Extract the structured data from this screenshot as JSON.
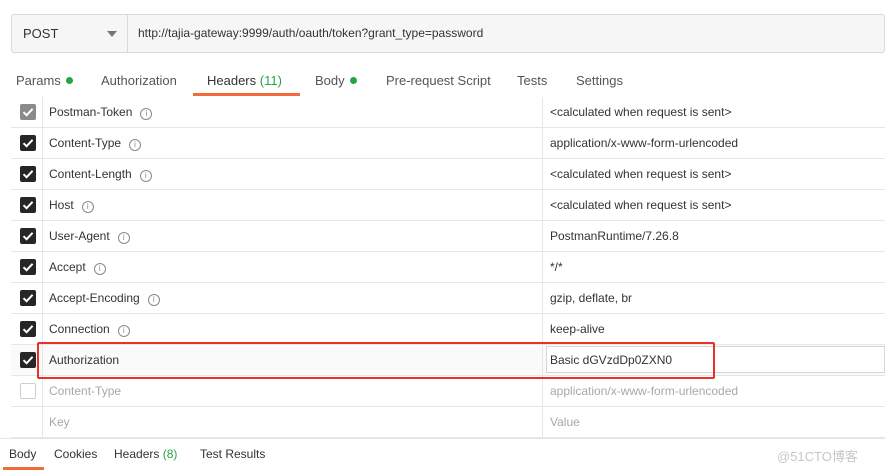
{
  "request": {
    "method": "POST",
    "url": "http://tajia-gateway:9999/auth/oauth/token?grant_type=password"
  },
  "tabs": [
    {
      "label": "Params",
      "dot": true
    },
    {
      "label": "Authorization"
    },
    {
      "label": "Headers",
      "count": "(11)",
      "active": true
    },
    {
      "label": "Body",
      "dot": true
    },
    {
      "label": "Pre-request Script"
    },
    {
      "label": "Tests"
    },
    {
      "label": "Settings"
    }
  ],
  "headers": [
    {
      "key": "Postman-Token",
      "value": "<calculated when request is sent>",
      "checked": true,
      "disabled": true,
      "info": true
    },
    {
      "key": "Content-Type",
      "value": "application/x-www-form-urlencoded",
      "checked": true,
      "info": true
    },
    {
      "key": "Content-Length",
      "value": "<calculated when request is sent>",
      "checked": true,
      "info": true
    },
    {
      "key": "Host",
      "value": "<calculated when request is sent>",
      "checked": true,
      "info": true
    },
    {
      "key": "User-Agent",
      "value": "PostmanRuntime/7.26.8",
      "checked": true,
      "info": true
    },
    {
      "key": "Accept",
      "value": "*/*",
      "checked": true,
      "info": true
    },
    {
      "key": "Accept-Encoding",
      "value": "gzip, deflate, br",
      "checked": true,
      "info": true
    },
    {
      "key": "Connection",
      "value": "keep-alive",
      "checked": true,
      "info": true
    },
    {
      "key": "Authorization",
      "value": "Basic dGVzdDp0ZXN0",
      "checked": true,
      "highlighted": true
    },
    {
      "key": "Content-Type",
      "value": "application/x-www-form-urlencoded",
      "checked": false
    }
  ],
  "new_row": {
    "key_placeholder": "Key",
    "value_placeholder": "Value"
  },
  "info_glyph": "i",
  "response_tabs": [
    {
      "label": "Body",
      "active": true
    },
    {
      "label": "Cookies"
    },
    {
      "label": "Headers",
      "count": "(8)"
    },
    {
      "label": "Test Results"
    }
  ],
  "watermark": "@51CTO博客",
  "colors": {
    "accent": "#f26b3a",
    "green": "#26a544",
    "highlight": "#e6332a"
  }
}
